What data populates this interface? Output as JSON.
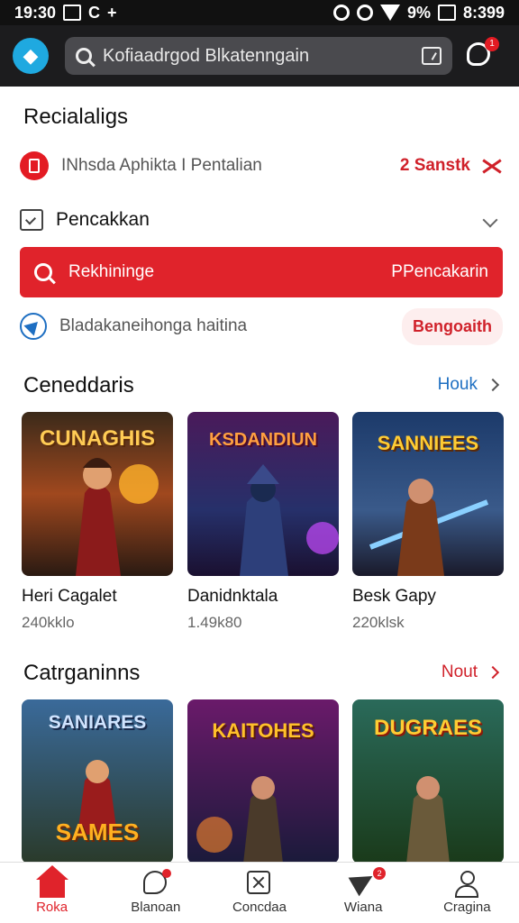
{
  "status_bar": {
    "time": "19:30",
    "carrier": "C",
    "battery": "9%",
    "clock_right": "8:399"
  },
  "header": {
    "search_text": "Kofiaadrgod Blkatenngain",
    "notification_count": "1"
  },
  "recent": {
    "title": "Recialaligs",
    "item1": {
      "label": "INhsda Aphikta I Pentalian",
      "action": "2 Sanstk"
    },
    "item2": {
      "label": "Pencakkan"
    },
    "search_bar": {
      "label": "Rekhininge",
      "action": "PPencakarin"
    },
    "item3": {
      "label": "Bladakaneihonga haitina",
      "action": "Bengoaith"
    }
  },
  "featured": {
    "title": "Ceneddaris",
    "see_all": "Houk",
    "cards": [
      {
        "thumb_text": "CUNAGHIS",
        "title": "Heri Cagalet",
        "sub": "240kklo"
      },
      {
        "thumb_text": "KSDANDIUN",
        "title": "Danidnktala",
        "sub": "1.49k80"
      },
      {
        "thumb_text": "SANNIEES",
        "title": "Besk Gapy",
        "sub": "220klsk"
      }
    ]
  },
  "categories": {
    "title": "Catrganinns",
    "see_all": "Nout",
    "cards": [
      {
        "thumb_text": "SANIARES",
        "thumb_text2": "SAMES"
      },
      {
        "thumb_text": "KAITOHES"
      },
      {
        "thumb_text": "DUGRAES"
      }
    ]
  },
  "bottom_nav": [
    {
      "label": "Roka",
      "icon": "home-icon",
      "active": true
    },
    {
      "label": "Blanoan",
      "icon": "chat-icon"
    },
    {
      "label": "Concdaa",
      "icon": "box-x-icon"
    },
    {
      "label": "Wiana",
      "icon": "send-icon",
      "badge": "2"
    },
    {
      "label": "Cragina",
      "icon": "user-icon"
    }
  ],
  "colors": {
    "accent": "#e0232b",
    "link": "#1e6fc2",
    "header_bg": "#1c1c1e"
  }
}
